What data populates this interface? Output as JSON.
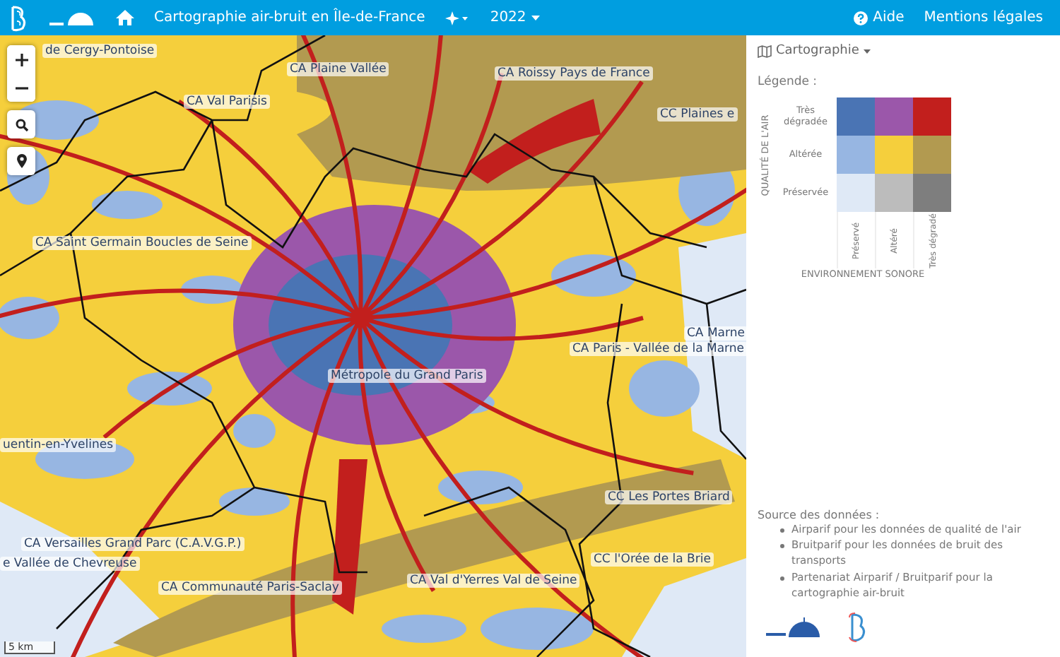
{
  "header": {
    "title": "Cartographie air-bruit en Île-de-France",
    "year": "2022",
    "help": "Aide",
    "legal": "Mentions légales"
  },
  "map": {
    "labels": [
      "de Cergy-Pontoise",
      "CA Plaine Vallée",
      "CA Roissy Pays de France",
      "CA Val Parisis",
      "CC Plaines e",
      "CA Saint Germain Boucles de Seine",
      "CA Marne",
      "CA Paris - Vallée de la Marne",
      "Métropole du Grand Paris",
      "uentin-en-Yvelines",
      "CC Les Portes Briard",
      "CA Versailles Grand Parc (C.A.V.G.P.)",
      "e Vallée de Chevreuse",
      "CC l'Orée de la Brie",
      "CA Communauté Paris-Saclay",
      "CA Val d'Yerres Val de Seine"
    ],
    "scale": "5 km"
  },
  "panel": {
    "view": "Cartographie",
    "legend_title": "Légende :",
    "y_axis": "QUALITÉ DE L'AIR",
    "x_axis": "ENVIRONNEMENT SONORE",
    "rows": [
      {
        "label": "Très dégradée",
        "cells": [
          {
            "color": "#4a74b4"
          },
          {
            "color": "#9b57aa"
          },
          {
            "color": "#c21f1d"
          }
        ]
      },
      {
        "label": "Altérée",
        "cells": [
          {
            "color": "#97b6e2"
          },
          {
            "color": "#f5cf3c"
          },
          {
            "color": "#b29a50"
          }
        ]
      },
      {
        "label": "Préservée",
        "cells": [
          {
            "color": "#dfe9f6"
          },
          {
            "color": "#bcbcbc"
          },
          {
            "color": "#7e7e7e"
          }
        ]
      }
    ],
    "columns": [
      "Préservé",
      "Altéré",
      "Très dégradé"
    ],
    "source_title": "Source des données :",
    "sources": [
      "Airparif pour les données de qualité de l'air",
      "Bruitparif pour les données de bruit des transports",
      "Partenariat Airparif / Bruitparif pour la cartographie air-bruit"
    ]
  }
}
